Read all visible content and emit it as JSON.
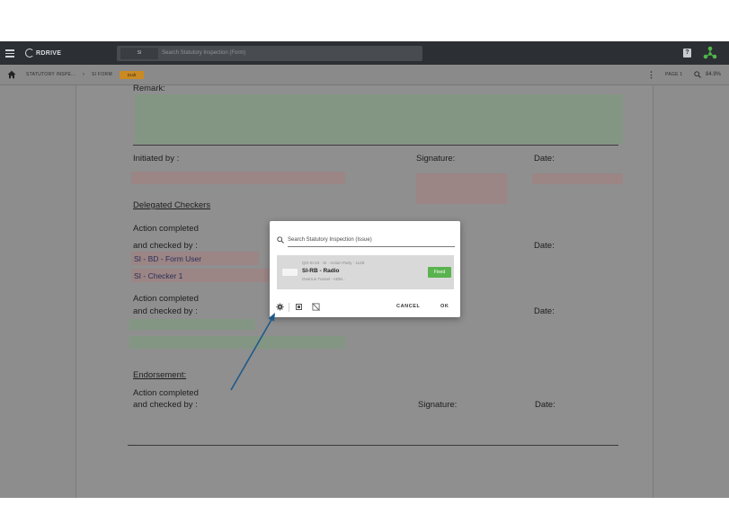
{
  "appbar": {
    "logo_text": "RDRIVE",
    "search_chip": "SI",
    "search_placeholder": "Search Statutory Inspection (Form)",
    "help_glyph": "?"
  },
  "breadcrumb": {
    "item1": "STATUTORY INSPE...",
    "separator": "›",
    "item2": "SI FORM",
    "status": "Draft",
    "page": "PAGE 1",
    "zoom": "84.9%"
  },
  "document": {
    "remark_label": "Remark:",
    "initiated_label": "Initiated by :",
    "signature_label_1": "Signature:",
    "date_label_1": "Date:",
    "delegated_heading": "Delegated Checkers",
    "action_completed_1": "Action completed",
    "checked_by_1": "and checked by :",
    "checker_user_1": "SI - BD - Form User",
    "checker_user_2": "SI - Checker 1",
    "date_label_2": "Date:",
    "action_completed_2": "Action completed",
    "checked_by_2": "and checked by :",
    "date_label_3": "Date:",
    "endorsement_heading": "Endorsement:",
    "action_completed_3": "Action completed",
    "checked_by_3": "and checked by :",
    "signature_label_2": "Signature:",
    "date_label_4": "Date:"
  },
  "dialog": {
    "search_placeholder": "Search Statutory Inspection (Issue)",
    "result": {
      "line1": "QO-SI-23 · SI · Action Party · 1128",
      "title": "SI-RB - Radio",
      "line3": "Overrun Tunnel · ADM...",
      "status": "Fixed"
    },
    "cancel_label": "CANCEL",
    "ok_label": "OK"
  },
  "colors": {
    "appbar": "#2c2f33",
    "overlay": "#8d8d8d",
    "status_draft": "#c98a24",
    "status_fixed": "#5ab34e",
    "arrow": "#1f5a8a"
  }
}
